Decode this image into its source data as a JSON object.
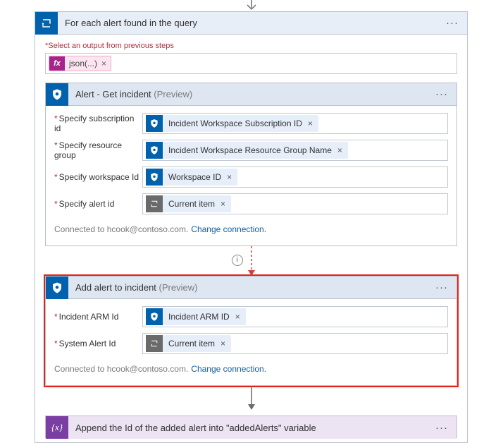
{
  "foreach": {
    "title": "For each alert found in the query",
    "outputs_label": "Select an output from previous steps",
    "output_token": "json(...)"
  },
  "get_incident": {
    "title": "Alert - Get incident",
    "preview": "(Preview)",
    "params": {
      "subscription": {
        "label": "Specify subscription id",
        "token": "Incident Workspace Subscription ID"
      },
      "resource_group": {
        "label": "Specify resource group",
        "token": "Incident Workspace Resource Group Name"
      },
      "workspace": {
        "label": "Specify workspace Id",
        "token": "Workspace ID"
      },
      "alert": {
        "label": "Specify alert id",
        "token": "Current item"
      }
    },
    "connected": "Connected to hcook@contoso.com.",
    "change": "Change connection."
  },
  "add_alert": {
    "title": "Add alert to incident",
    "preview": "(Preview)",
    "params": {
      "arm": {
        "label": "Incident ARM Id",
        "token": "Incident ARM ID"
      },
      "sys": {
        "label": "System Alert Id",
        "token": "Current item"
      }
    },
    "connected": "Connected to hcook@contoso.com.",
    "change": "Change connection."
  },
  "append": {
    "title": "Append the Id of the added alert into \"addedAlerts\" variable"
  }
}
